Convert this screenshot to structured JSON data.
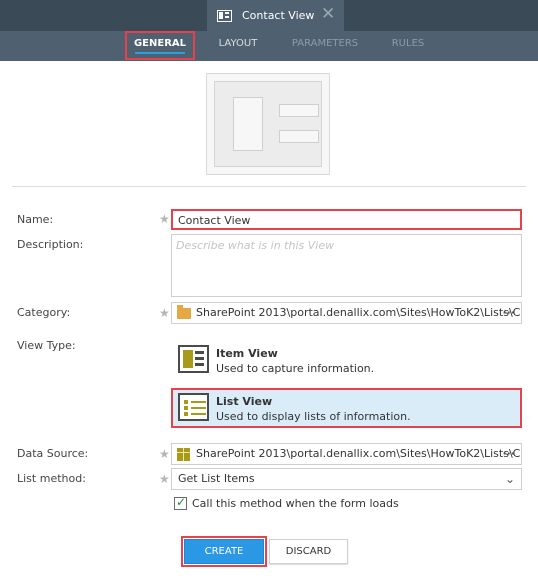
{
  "window": {
    "tab_title": "Contact View",
    "close_glyph": "✕"
  },
  "tabs": [
    {
      "label": "GENERAL"
    },
    {
      "label": "LAYOUT"
    },
    {
      "label": "PARAMETERS"
    },
    {
      "label": "RULES"
    }
  ],
  "form": {
    "name_label": "Name:",
    "name_value": "Contact View",
    "description_label": "Description:",
    "description_placeholder": "Describe what is in this View",
    "category_label": "Category:",
    "category_value": "SharePoint 2013\\portal.denallix.com\\Sites\\HowToK2\\Lists\\C",
    "view_type_label": "View Type:",
    "view_types": [
      {
        "title": "Item View",
        "description": "Used to capture information."
      },
      {
        "title": "List View",
        "description": "Used to display lists of information."
      }
    ],
    "data_source_label": "Data Source:",
    "data_source_value": "SharePoint 2013\\portal.denallix.com\\Sites\\HowToK2\\Lists\\C",
    "list_method_label": "List method:",
    "list_method_value": "Get List Items",
    "call_on_load_label": "Call this method when the form loads",
    "call_on_load_checked": true,
    "required_marker": "★",
    "ellipsis": "···"
  },
  "buttons": {
    "create": "CREATE",
    "discard": "DISCARD"
  },
  "icons": [
    "view-tab-icon",
    "close-icon",
    "folder-icon",
    "smartobject-icon",
    "item-view-icon",
    "list-view-icon",
    "chevron-down-icon",
    "checkmark-icon"
  ],
  "colors": {
    "accent": "#2a98e4",
    "highlight": "#e5424d",
    "selected_bg": "#d9ecf8",
    "header_bg": "#3a4a56"
  }
}
